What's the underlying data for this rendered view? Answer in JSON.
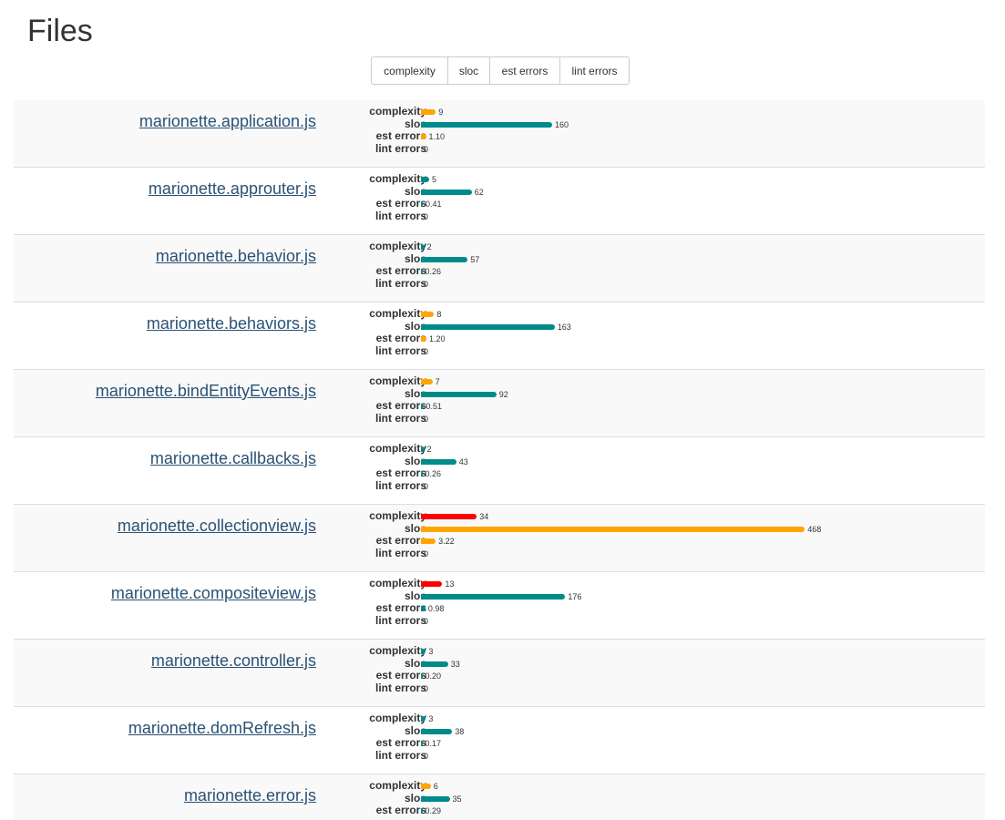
{
  "page": {
    "title": "Files"
  },
  "sort_buttons": [
    {
      "label": "complexity"
    },
    {
      "label": "sloc"
    },
    {
      "label": "est errors"
    },
    {
      "label": "lint errors"
    }
  ],
  "colors": {
    "good": "#008b8b",
    "warning": "#ffa500",
    "danger": "#ff0000"
  },
  "metric_labels": [
    "complexity",
    "sloc",
    "est errors",
    "lint errors"
  ],
  "files": [
    {
      "name": "marionette.application.js",
      "metrics": [
        {
          "label": "complexity",
          "value": 9,
          "display": "9",
          "level": "warning"
        },
        {
          "label": "sloc",
          "value": 160,
          "display": "160",
          "level": "good"
        },
        {
          "label": "est errors",
          "value": 1.1,
          "display": "1.10",
          "level": "warning"
        },
        {
          "label": "lint errors",
          "value": 0,
          "display": "0",
          "level": "good"
        }
      ]
    },
    {
      "name": "marionette.approuter.js",
      "metrics": [
        {
          "label": "complexity",
          "value": 5,
          "display": "5",
          "level": "good"
        },
        {
          "label": "sloc",
          "value": 62,
          "display": "62",
          "level": "good"
        },
        {
          "label": "est errors",
          "value": 0.41,
          "display": "0.41",
          "level": "good"
        },
        {
          "label": "lint errors",
          "value": 0,
          "display": "0",
          "level": "good"
        }
      ]
    },
    {
      "name": "marionette.behavior.js",
      "metrics": [
        {
          "label": "complexity",
          "value": 2,
          "display": "2",
          "level": "good"
        },
        {
          "label": "sloc",
          "value": 57,
          "display": "57",
          "level": "good"
        },
        {
          "label": "est errors",
          "value": 0.26,
          "display": "0.26",
          "level": "good"
        },
        {
          "label": "lint errors",
          "value": 0,
          "display": "0",
          "level": "good"
        }
      ]
    },
    {
      "name": "marionette.behaviors.js",
      "metrics": [
        {
          "label": "complexity",
          "value": 8,
          "display": "8",
          "level": "warning"
        },
        {
          "label": "sloc",
          "value": 163,
          "display": "163",
          "level": "good"
        },
        {
          "label": "est errors",
          "value": 1.2,
          "display": "1.20",
          "level": "warning"
        },
        {
          "label": "lint errors",
          "value": 0,
          "display": "0",
          "level": "good"
        }
      ]
    },
    {
      "name": "marionette.bindEntityEvents.js",
      "metrics": [
        {
          "label": "complexity",
          "value": 7,
          "display": "7",
          "level": "warning"
        },
        {
          "label": "sloc",
          "value": 92,
          "display": "92",
          "level": "good"
        },
        {
          "label": "est errors",
          "value": 0.51,
          "display": "0.51",
          "level": "good"
        },
        {
          "label": "lint errors",
          "value": 0,
          "display": "0",
          "level": "good"
        }
      ]
    },
    {
      "name": "marionette.callbacks.js",
      "metrics": [
        {
          "label": "complexity",
          "value": 2,
          "display": "2",
          "level": "good"
        },
        {
          "label": "sloc",
          "value": 43,
          "display": "43",
          "level": "good"
        },
        {
          "label": "est errors",
          "value": 0.26,
          "display": "0.26",
          "level": "good"
        },
        {
          "label": "lint errors",
          "value": 0,
          "display": "0",
          "level": "good"
        }
      ]
    },
    {
      "name": "marionette.collectionview.js",
      "metrics": [
        {
          "label": "complexity",
          "value": 34,
          "display": "34",
          "level": "danger"
        },
        {
          "label": "sloc",
          "value": 468,
          "display": "468",
          "level": "warning"
        },
        {
          "label": "est errors",
          "value": 3.22,
          "display": "3.22",
          "level": "warning"
        },
        {
          "label": "lint errors",
          "value": 0,
          "display": "0",
          "level": "good"
        }
      ]
    },
    {
      "name": "marionette.compositeview.js",
      "metrics": [
        {
          "label": "complexity",
          "value": 13,
          "display": "13",
          "level": "danger"
        },
        {
          "label": "sloc",
          "value": 176,
          "display": "176",
          "level": "good"
        },
        {
          "label": "est errors",
          "value": 0.98,
          "display": "0.98",
          "level": "good"
        },
        {
          "label": "lint errors",
          "value": 0,
          "display": "0",
          "level": "good"
        }
      ]
    },
    {
      "name": "marionette.controller.js",
      "metrics": [
        {
          "label": "complexity",
          "value": 3,
          "display": "3",
          "level": "good"
        },
        {
          "label": "sloc",
          "value": 33,
          "display": "33",
          "level": "good"
        },
        {
          "label": "est errors",
          "value": 0.2,
          "display": "0.20",
          "level": "good"
        },
        {
          "label": "lint errors",
          "value": 0,
          "display": "0",
          "level": "good"
        }
      ]
    },
    {
      "name": "marionette.domRefresh.js",
      "metrics": [
        {
          "label": "complexity",
          "value": 3,
          "display": "3",
          "level": "good"
        },
        {
          "label": "sloc",
          "value": 38,
          "display": "38",
          "level": "good"
        },
        {
          "label": "est errors",
          "value": 0.17,
          "display": "0.17",
          "level": "good"
        },
        {
          "label": "lint errors",
          "value": 0,
          "display": "0",
          "level": "good"
        }
      ]
    },
    {
      "name": "marionette.error.js",
      "metrics": [
        {
          "label": "complexity",
          "value": 6,
          "display": "6",
          "level": "warning"
        },
        {
          "label": "sloc",
          "value": 35,
          "display": "35",
          "level": "good"
        },
        {
          "label": "est errors",
          "value": 0.29,
          "display": "0.29",
          "level": "good"
        }
      ]
    }
  ]
}
